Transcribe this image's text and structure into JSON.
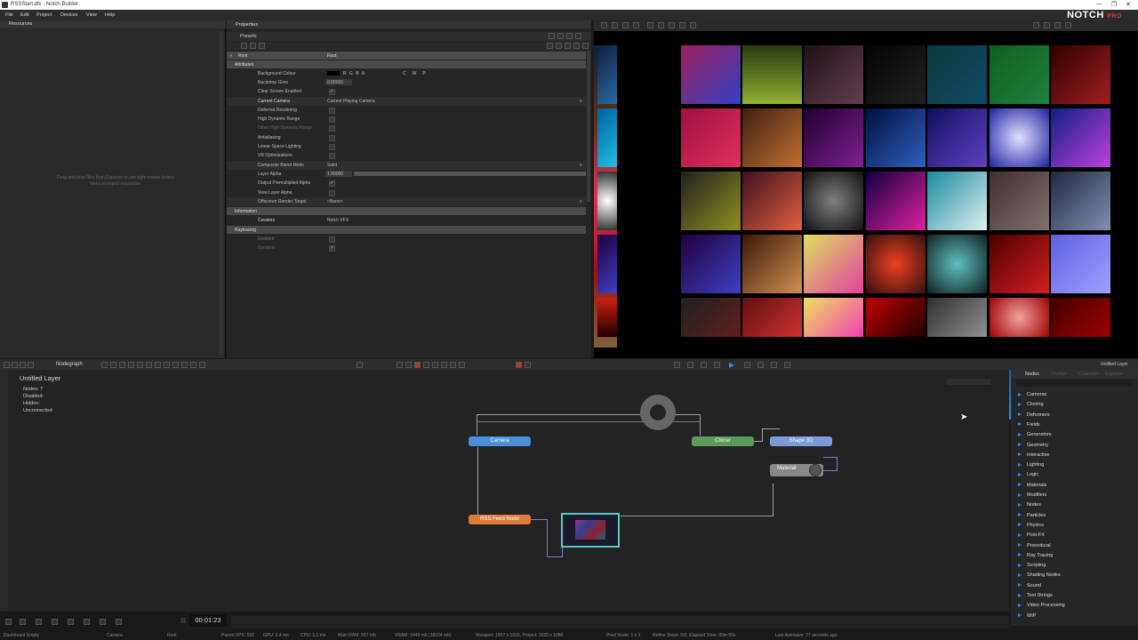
{
  "window": {
    "title": "RSSStart.dfx - Notch Builder",
    "min": "—",
    "max": "❐",
    "close": "✕"
  },
  "menu": [
    "File",
    "Edit",
    "Project",
    "Devices",
    "View",
    "Help"
  ],
  "brand": {
    "name": "NOTCH",
    "edition": "PRO"
  },
  "resources": {
    "title": "Resources",
    "hint": "Drag and drop files from Explorer or use right mouse button menu to import resources."
  },
  "properties": {
    "title": "Properties",
    "presets": "Presets",
    "root_label": "Root",
    "root_value": "Root",
    "sections": {
      "attributes": "Attributes",
      "information": "Information",
      "raytracing": "Raytracing"
    },
    "rows": [
      {
        "label": "Background Colour",
        "value": "R G B A"
      },
      {
        "label": "Backdrop Glow",
        "value": "0.00000"
      },
      {
        "label": "Clear Screen Enabled",
        "value": "✓"
      },
      {
        "label": "Current Camera",
        "value": "Current Playing Camera"
      },
      {
        "label": "Deferred Rendering",
        "value": ""
      },
      {
        "label": "High Dynamic Range",
        "value": ""
      },
      {
        "label": "Other High Dynamic Range",
        "value": ""
      },
      {
        "label": "Antialiasing",
        "value": ""
      },
      {
        "label": "Linear-Space Lighting",
        "value": ""
      },
      {
        "label": "VR Optimisations",
        "value": ""
      },
      {
        "label": "Composite Blend Mode",
        "value": "Solid"
      },
      {
        "label": "Layer Alpha",
        "value": "1.00000"
      },
      {
        "label": "Output Premultiplied Alpha",
        "value": "✓"
      },
      {
        "label": "View Layer Alpha",
        "value": ""
      },
      {
        "label": "Offscreen Render Target",
        "value": "<None>"
      }
    ],
    "info_rows": [
      {
        "label": "Creators",
        "value": "Notch VFX"
      }
    ],
    "ray_rows": [
      {
        "label": "Enabled",
        "value": ""
      },
      {
        "label": "Dynamic",
        "value": "✓"
      }
    ]
  },
  "nodegraph": {
    "tab": "Nodegraph",
    "layer_title": "Untitled Layer",
    "stats": [
      "Nodes: 7",
      "Disabled:",
      "Hidden:",
      "Unconnected:"
    ],
    "nodes": {
      "camera": "Camera",
      "cloner": "Cloner",
      "shape": "Shape 3D",
      "material": "Material",
      "rss": "RSS Feed Node"
    }
  },
  "right_panel": {
    "tabs": [
      "Nodes",
      "Profiler",
      "Channels",
      "Explorer"
    ],
    "layer_tag": "Untitled Layer",
    "categories": [
      "Cameras",
      "Cloning",
      "Deformers",
      "Fields",
      "Generators",
      "Geometry",
      "Interactive",
      "Lighting",
      "Logic",
      "Materials",
      "Modifiers",
      "Nodes",
      "Particles",
      "Physics",
      "Post-FX",
      "Procedural",
      "Ray Tracing",
      "Scripting",
      "Shading Nodes",
      "Sound",
      "Text Strings",
      "Video Processing",
      "WIP"
    ]
  },
  "timeline": {
    "time": "00:01:23"
  },
  "status": {
    "items": [
      "Dashboard Empty",
      "Camera",
      "Root",
      "Parent FPS: 532",
      "GPU: 2.4 ms",
      "CPU: 1.1 ms",
      "Main RAM: 557 mb",
      "VRAM: 1449 mb (18224 mb)",
      "Viewport: 1807 x 1016, Project: 1920 x 1080",
      "Pixel Scale: 1 x 1",
      "Refine Steps: 0/0, Elapsed Time: 00m:00s",
      "Last Autosave: 77 seconds ago"
    ]
  },
  "colors": {
    "accent": "#3b82f6",
    "camera_node": "#4a8fd8",
    "cloner_node": "#5a9a5a",
    "shape_node": "#7a9ad8",
    "rss_node": "#e07a3a",
    "material_node": "#888888"
  }
}
